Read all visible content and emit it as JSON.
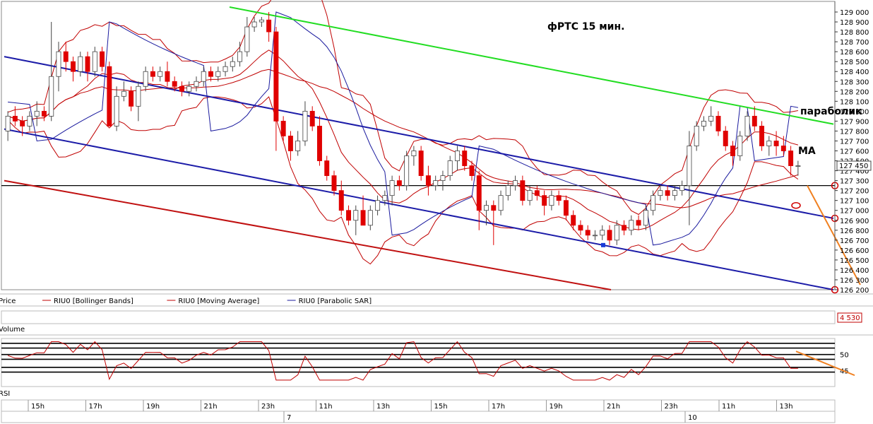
{
  "chart_data": [
    {
      "type": "candlestick",
      "title": "фРТС   15 мин.",
      "legend": [
        {
          "label": "Price",
          "color": "#000000"
        },
        {
          "label": "RIU0 [Bollinger Bands]",
          "color": "#c00000"
        },
        {
          "label": "RIU0 [Moving Average]",
          "color": "#c00000"
        },
        {
          "label": "RIU0 [Parabolic SAR]",
          "color": "#1a1a9e"
        }
      ],
      "y_ticks": [
        129000,
        128900,
        128800,
        128700,
        128600,
        128500,
        128400,
        128300,
        128200,
        128100,
        128000,
        127900,
        127800,
        127700,
        127600,
        127500,
        127400,
        127300,
        127200,
        127100,
        127000,
        126900,
        126800,
        126700,
        126600,
        126500,
        126400,
        126300,
        126200
      ],
      "y_tick_labels": [
        "129 000",
        "128 900",
        "128 800",
        "128 700",
        "128 600",
        "128 500",
        "128 400",
        "128 300",
        "128 200",
        "128 100",
        "128 000",
        "127 900",
        "127 800",
        "127 700",
        "127 600",
        "127 500",
        "127 400",
        "127 300",
        "127 200",
        "127 100",
        "127 000",
        "126 900",
        "126 800",
        "126 700",
        "126 600",
        "126 500",
        "126 400",
        "126 300",
        "126 200"
      ],
      "ylim": [
        126200,
        129000
      ],
      "last_price_label": "127 450",
      "last_price": 127450,
      "horizontal_line": 127250,
      "annotations": [
        "параболик",
        "MA"
      ],
      "candles": [
        [
          127800,
          128000,
          127700,
          127950
        ],
        [
          127950,
          128050,
          127850,
          127900
        ],
        [
          127900,
          127950,
          127750,
          127850
        ],
        [
          127850,
          128000,
          127800,
          127950
        ],
        [
          127950,
          128100,
          127850,
          128000
        ],
        [
          128000,
          128050,
          127900,
          127950
        ],
        [
          127950,
          128900,
          127900,
          128350
        ],
        [
          128350,
          128700,
          128200,
          128600
        ],
        [
          128600,
          128700,
          128400,
          128500
        ],
        [
          128500,
          128550,
          128300,
          128400
        ],
        [
          128400,
          128600,
          128350,
          128550
        ],
        [
          128550,
          128600,
          128300,
          128400
        ],
        [
          128400,
          128650,
          128350,
          128600
        ],
        [
          128600,
          128650,
          128400,
          128450
        ],
        [
          128450,
          128500,
          127900,
          127850
        ],
        [
          127850,
          128250,
          127800,
          128150
        ],
        [
          128150,
          128300,
          128100,
          128200
        ],
        [
          128200,
          128250,
          128000,
          128050
        ],
        [
          128050,
          128300,
          127900,
          128250
        ],
        [
          128250,
          128450,
          128200,
          128400
        ],
        [
          128400,
          128450,
          128300,
          128350
        ],
        [
          128350,
          128450,
          128300,
          128400
        ],
        [
          128400,
          128500,
          128250,
          128300
        ],
        [
          128300,
          128350,
          128200,
          128250
        ],
        [
          128250,
          128300,
          128150,
          128200
        ],
        [
          128200,
          128300,
          128150,
          128250
        ],
        [
          128250,
          128350,
          128200,
          128300
        ],
        [
          128300,
          128450,
          128250,
          128400
        ],
        [
          128400,
          128450,
          128300,
          128350
        ],
        [
          128350,
          128450,
          128300,
          128400
        ],
        [
          128400,
          128500,
          128350,
          128450
        ],
        [
          128450,
          128550,
          128400,
          128500
        ],
        [
          128500,
          128700,
          128450,
          128600
        ],
        [
          128600,
          128950,
          128550,
          128850
        ],
        [
          128850,
          128950,
          128800,
          128900
        ],
        [
          128900,
          128950,
          128850,
          128920
        ],
        [
          128920,
          129000,
          128700,
          128800
        ],
        [
          128800,
          128850,
          127600,
          127900
        ],
        [
          127900,
          127950,
          127700,
          127750
        ],
        [
          127750,
          127800,
          127500,
          127600
        ],
        [
          127600,
          127800,
          127550,
          127700
        ],
        [
          127700,
          128100,
          127650,
          128000
        ],
        [
          128000,
          128050,
          127800,
          127850
        ],
        [
          127850,
          127950,
          127450,
          127500
        ],
        [
          127500,
          127550,
          127300,
          127350
        ],
        [
          127350,
          127400,
          127150,
          127200
        ],
        [
          127200,
          127300,
          126950,
          127000
        ],
        [
          127000,
          127050,
          126850,
          126900
        ],
        [
          126900,
          127050,
          126750,
          127000
        ],
        [
          127000,
          127150,
          126850,
          126850
        ],
        [
          126850,
          127050,
          126800,
          127000
        ],
        [
          127000,
          127150,
          126950,
          127100
        ],
        [
          127100,
          127200,
          127050,
          127150
        ],
        [
          127150,
          127350,
          127050,
          127300
        ],
        [
          127300,
          127350,
          127200,
          127250
        ],
        [
          127250,
          127600,
          127200,
          127550
        ],
        [
          127550,
          127650,
          127450,
          127600
        ],
        [
          127600,
          127650,
          127300,
          127350
        ],
        [
          127350,
          127450,
          127150,
          127250
        ],
        [
          127250,
          127350,
          127200,
          127300
        ],
        [
          127300,
          127400,
          127200,
          127350
        ],
        [
          127350,
          127550,
          127300,
          127500
        ],
        [
          127500,
          127650,
          127400,
          127600
        ],
        [
          127600,
          127650,
          127400,
          127450
        ],
        [
          127450,
          127500,
          127300,
          127350
        ],
        [
          127350,
          127400,
          126800,
          127000
        ],
        [
          127000,
          127100,
          126850,
          127050
        ],
        [
          127050,
          127100,
          126650,
          127000
        ],
        [
          127000,
          127200,
          126950,
          127150
        ],
        [
          127150,
          127300,
          127100,
          127250
        ],
        [
          127250,
          127350,
          127200,
          127300
        ],
        [
          127300,
          127350,
          127050,
          127100
        ],
        [
          127100,
          127250,
          127050,
          127200
        ],
        [
          127200,
          127250,
          127100,
          127150
        ],
        [
          127150,
          127200,
          126950,
          127050
        ],
        [
          127050,
          127200,
          127000,
          127150
        ],
        [
          127150,
          127200,
          127050,
          127100
        ],
        [
          127100,
          127150,
          126900,
          126950
        ],
        [
          126950,
          127000,
          126800,
          126850
        ],
        [
          126850,
          126900,
          126750,
          126800
        ],
        [
          126800,
          126850,
          126700,
          126750
        ],
        [
          126750,
          126800,
          126700,
          126750
        ],
        [
          126750,
          126850,
          126700,
          126800
        ],
        [
          126800,
          126850,
          126650,
          126700
        ],
        [
          126700,
          126900,
          126650,
          126850
        ],
        [
          126850,
          126900,
          126750,
          126800
        ],
        [
          126800,
          126950,
          126750,
          126900
        ],
        [
          126900,
          126950,
          126800,
          126850
        ],
        [
          126850,
          127050,
          126800,
          127000
        ],
        [
          127000,
          127200,
          126950,
          127150
        ],
        [
          127150,
          127250,
          127100,
          127200
        ],
        [
          127200,
          127250,
          127100,
          127150
        ],
        [
          127150,
          127250,
          127100,
          127200
        ],
        [
          127200,
          127300,
          127150,
          127250
        ],
        [
          127250,
          127800,
          126850,
          127650
        ],
        [
          127650,
          127900,
          127600,
          127850
        ],
        [
          127850,
          127950,
          127800,
          127900
        ],
        [
          127900,
          128050,
          127850,
          127950
        ],
        [
          127950,
          128000,
          127750,
          127800
        ],
        [
          127800,
          127850,
          127600,
          127650
        ],
        [
          127650,
          127700,
          127450,
          127550
        ],
        [
          127550,
          127800,
          127500,
          127750
        ],
        [
          127750,
          128000,
          127700,
          127950
        ],
        [
          127950,
          128050,
          127800,
          127850
        ],
        [
          127850,
          127900,
          127600,
          127650
        ],
        [
          127650,
          127750,
          127550,
          127700
        ],
        [
          127700,
          127800,
          127550,
          127650
        ],
        [
          127650,
          127750,
          127550,
          127600
        ],
        [
          127600,
          127650,
          127350,
          127450
        ],
        [
          127450,
          127500,
          127350,
          127450
        ]
      ],
      "time_labels": [
        "15h",
        "17h",
        "19h",
        "21h",
        "23h",
        "11h",
        "13h",
        "15h",
        "17h",
        "19h",
        "21h",
        "23h",
        "11h",
        "13h"
      ],
      "date_labels": [
        "7",
        "10"
      ],
      "volume_label": "Volume",
      "volume_badge": "4 530",
      "rsi_label": "RSI",
      "rsi_ticks": [
        50,
        45
      ],
      "colors": {
        "up": "#ffffff",
        "down": "#e00000",
        "bollinger": "#c00000",
        "sar": "#1a1a9e",
        "green_line": "#22dd22",
        "blue_channel": "#1c1ca8",
        "red_channel": "#c01010",
        "arrow": "#f08020"
      }
    }
  ]
}
